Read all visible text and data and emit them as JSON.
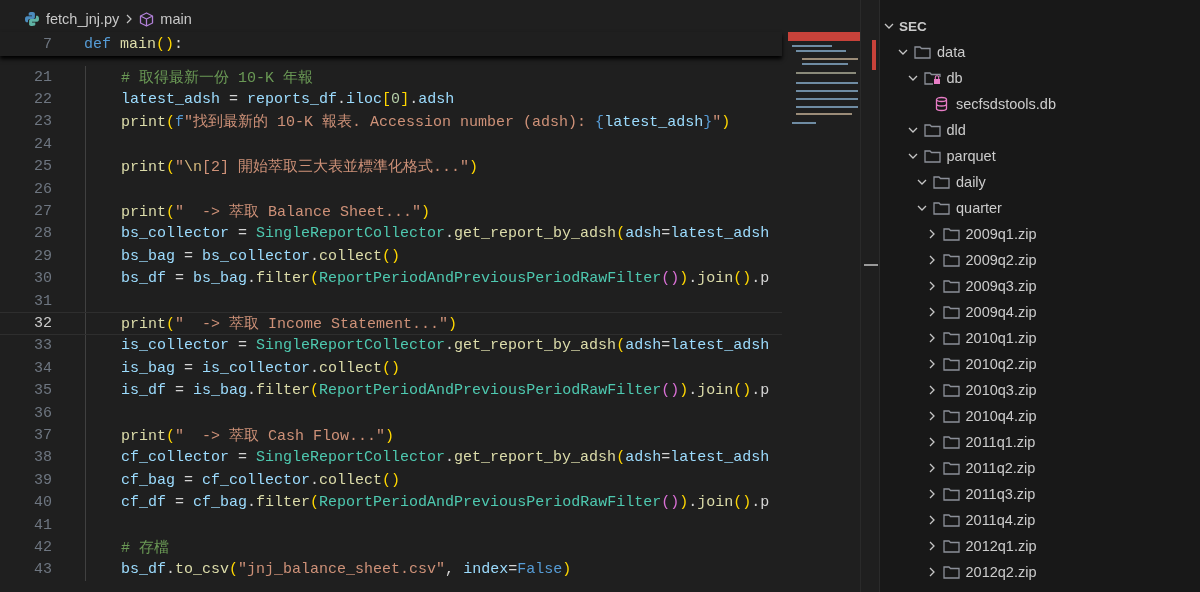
{
  "breadcrumb": {
    "file": "fetch_jnj.py",
    "symbol": "main"
  },
  "sticky_line": {
    "number": "7",
    "tokens": [
      {
        "text": "def ",
        "kind": "kw"
      },
      {
        "text": "main",
        "kind": "fn"
      },
      {
        "text": "()",
        "kind": "p1"
      },
      {
        "text": ":",
        "kind": "op"
      }
    ]
  },
  "lines": [
    {
      "number": "21",
      "active": false,
      "tokens": [
        {
          "text": "# 取得最新一份 10-K 年報",
          "kind": "cmt"
        }
      ]
    },
    {
      "number": "22",
      "active": false,
      "tokens": [
        {
          "text": "latest_adsh",
          "kind": "var"
        },
        {
          "text": " = ",
          "kind": "op"
        },
        {
          "text": "reports_df",
          "kind": "var"
        },
        {
          "text": ".",
          "kind": "op"
        },
        {
          "text": "iloc",
          "kind": "var"
        },
        {
          "text": "[",
          "kind": "p1"
        },
        {
          "text": "0",
          "kind": "num"
        },
        {
          "text": "]",
          "kind": "p1"
        },
        {
          "text": ".",
          "kind": "op"
        },
        {
          "text": "adsh",
          "kind": "var"
        }
      ]
    },
    {
      "number": "23",
      "active": false,
      "tokens": [
        {
          "text": "print",
          "kind": "fn"
        },
        {
          "text": "(",
          "kind": "p1"
        },
        {
          "text": "f",
          "kind": "kw"
        },
        {
          "text": "\"找到最新的 10-K 報表. Accession number (adsh): ",
          "kind": "str"
        },
        {
          "text": "{",
          "kind": "kw"
        },
        {
          "text": "latest_adsh",
          "kind": "var"
        },
        {
          "text": "}",
          "kind": "kw"
        },
        {
          "text": "\"",
          "kind": "str"
        },
        {
          "text": ")",
          "kind": "p1"
        }
      ]
    },
    {
      "number": "24",
      "active": false
    },
    {
      "number": "25",
      "active": false,
      "tokens": [
        {
          "text": "print",
          "kind": "fn"
        },
        {
          "text": "(",
          "kind": "p1"
        },
        {
          "text": "\"",
          "kind": "str"
        },
        {
          "text": "\\n",
          "kind": "esc"
        },
        {
          "text": "[2] 開始萃取三大表並標準化格式...\"",
          "kind": "str"
        },
        {
          "text": ")",
          "kind": "p1"
        }
      ]
    },
    {
      "number": "26",
      "active": false
    },
    {
      "number": "27",
      "active": false,
      "tokens": [
        {
          "text": "print",
          "kind": "fn"
        },
        {
          "text": "(",
          "kind": "p1"
        },
        {
          "text": "\"  -> 萃取 Balance Sheet...\"",
          "kind": "str"
        },
        {
          "text": ")",
          "kind": "p1"
        }
      ]
    },
    {
      "number": "28",
      "active": false,
      "tokens": [
        {
          "text": "bs_collector",
          "kind": "var"
        },
        {
          "text": " = ",
          "kind": "op"
        },
        {
          "text": "SingleReportCollector",
          "kind": "cls"
        },
        {
          "text": ".",
          "kind": "op"
        },
        {
          "text": "get_report_by_adsh",
          "kind": "fn"
        },
        {
          "text": "(",
          "kind": "p1"
        },
        {
          "text": "adsh",
          "kind": "var"
        },
        {
          "text": "=",
          "kind": "op"
        },
        {
          "text": "latest_adsh",
          "kind": "var"
        }
      ]
    },
    {
      "number": "29",
      "active": false,
      "tokens": [
        {
          "text": "bs_bag",
          "kind": "var"
        },
        {
          "text": " = ",
          "kind": "op"
        },
        {
          "text": "bs_collector",
          "kind": "var"
        },
        {
          "text": ".",
          "kind": "op"
        },
        {
          "text": "collect",
          "kind": "fn"
        },
        {
          "text": "()",
          "kind": "p1"
        }
      ]
    },
    {
      "number": "30",
      "active": false,
      "tokens": [
        {
          "text": "bs_df",
          "kind": "var"
        },
        {
          "text": " = ",
          "kind": "op"
        },
        {
          "text": "bs_bag",
          "kind": "var"
        },
        {
          "text": ".",
          "kind": "op"
        },
        {
          "text": "filter",
          "kind": "fn"
        },
        {
          "text": "(",
          "kind": "p1"
        },
        {
          "text": "ReportPeriodAndPreviousPeriodRawFilter",
          "kind": "cls"
        },
        {
          "text": "()",
          "kind": "p2"
        },
        {
          "text": ")",
          "kind": "p1"
        },
        {
          "text": ".",
          "kind": "op"
        },
        {
          "text": "join",
          "kind": "fn"
        },
        {
          "text": "()",
          "kind": "p1"
        },
        {
          "text": ".p",
          "kind": "op"
        }
      ]
    },
    {
      "number": "31",
      "active": false
    },
    {
      "number": "32",
      "active": true,
      "tokens": [
        {
          "text": "print",
          "kind": "fn"
        },
        {
          "text": "(",
          "kind": "p1"
        },
        {
          "text": "\"  -> 萃取 Income Statement...\"",
          "kind": "str"
        },
        {
          "text": ")",
          "kind": "p1"
        }
      ]
    },
    {
      "number": "33",
      "active": false,
      "tokens": [
        {
          "text": "is_collector",
          "kind": "var"
        },
        {
          "text": " = ",
          "kind": "op"
        },
        {
          "text": "SingleReportCollector",
          "kind": "cls"
        },
        {
          "text": ".",
          "kind": "op"
        },
        {
          "text": "get_report_by_adsh",
          "kind": "fn"
        },
        {
          "text": "(",
          "kind": "p1"
        },
        {
          "text": "adsh",
          "kind": "var"
        },
        {
          "text": "=",
          "kind": "op"
        },
        {
          "text": "latest_adsh",
          "kind": "var"
        }
      ]
    },
    {
      "number": "34",
      "active": false,
      "tokens": [
        {
          "text": "is_bag",
          "kind": "var"
        },
        {
          "text": " = ",
          "kind": "op"
        },
        {
          "text": "is_collector",
          "kind": "var"
        },
        {
          "text": ".",
          "kind": "op"
        },
        {
          "text": "collect",
          "kind": "fn"
        },
        {
          "text": "()",
          "kind": "p1"
        }
      ]
    },
    {
      "number": "35",
      "active": false,
      "tokens": [
        {
          "text": "is_df",
          "kind": "var"
        },
        {
          "text": " = ",
          "kind": "op"
        },
        {
          "text": "is_bag",
          "kind": "var"
        },
        {
          "text": ".",
          "kind": "op"
        },
        {
          "text": "filter",
          "kind": "fn"
        },
        {
          "text": "(",
          "kind": "p1"
        },
        {
          "text": "ReportPeriodAndPreviousPeriodRawFilter",
          "kind": "cls"
        },
        {
          "text": "()",
          "kind": "p2"
        },
        {
          "text": ")",
          "kind": "p1"
        },
        {
          "text": ".",
          "kind": "op"
        },
        {
          "text": "join",
          "kind": "fn"
        },
        {
          "text": "()",
          "kind": "p1"
        },
        {
          "text": ".p",
          "kind": "op"
        }
      ]
    },
    {
      "number": "36",
      "active": false
    },
    {
      "number": "37",
      "active": false,
      "tokens": [
        {
          "text": "print",
          "kind": "fn"
        },
        {
          "text": "(",
          "kind": "p1"
        },
        {
          "text": "\"  -> 萃取 Cash Flow...\"",
          "kind": "str"
        },
        {
          "text": ")",
          "kind": "p1"
        }
      ]
    },
    {
      "number": "38",
      "active": false,
      "tokens": [
        {
          "text": "cf_collector",
          "kind": "var"
        },
        {
          "text": " = ",
          "kind": "op"
        },
        {
          "text": "SingleReportCollector",
          "kind": "cls"
        },
        {
          "text": ".",
          "kind": "op"
        },
        {
          "text": "get_report_by_adsh",
          "kind": "fn"
        },
        {
          "text": "(",
          "kind": "p1"
        },
        {
          "text": "adsh",
          "kind": "var"
        },
        {
          "text": "=",
          "kind": "op"
        },
        {
          "text": "latest_adsh",
          "kind": "var"
        }
      ]
    },
    {
      "number": "39",
      "active": false,
      "tokens": [
        {
          "text": "cf_bag",
          "kind": "var"
        },
        {
          "text": " = ",
          "kind": "op"
        },
        {
          "text": "cf_collector",
          "kind": "var"
        },
        {
          "text": ".",
          "kind": "op"
        },
        {
          "text": "collect",
          "kind": "fn"
        },
        {
          "text": "()",
          "kind": "p1"
        }
      ]
    },
    {
      "number": "40",
      "active": false,
      "tokens": [
        {
          "text": "cf_df",
          "kind": "var"
        },
        {
          "text": " = ",
          "kind": "op"
        },
        {
          "text": "cf_bag",
          "kind": "var"
        },
        {
          "text": ".",
          "kind": "op"
        },
        {
          "text": "filter",
          "kind": "fn"
        },
        {
          "text": "(",
          "kind": "p1"
        },
        {
          "text": "ReportPeriodAndPreviousPeriodRawFilter",
          "kind": "cls"
        },
        {
          "text": "()",
          "kind": "p2"
        },
        {
          "text": ")",
          "kind": "p1"
        },
        {
          "text": ".",
          "kind": "op"
        },
        {
          "text": "join",
          "kind": "fn"
        },
        {
          "text": "()",
          "kind": "p1"
        },
        {
          "text": ".p",
          "kind": "op"
        }
      ]
    },
    {
      "number": "41",
      "active": false
    },
    {
      "number": "42",
      "active": false,
      "tokens": [
        {
          "text": "# 存檔",
          "kind": "cmt"
        }
      ]
    },
    {
      "number": "43",
      "active": false,
      "tokens": [
        {
          "text": "bs_df",
          "kind": "var"
        },
        {
          "text": ".",
          "kind": "op"
        },
        {
          "text": "to_csv",
          "kind": "fn"
        },
        {
          "text": "(",
          "kind": "p1"
        },
        {
          "text": "\"jnj_balance_sheet.csv\"",
          "kind": "str"
        },
        {
          "text": ", ",
          "kind": "op"
        },
        {
          "text": "index",
          "kind": "var"
        },
        {
          "text": "=",
          "kind": "op"
        },
        {
          "text": "False",
          "kind": "kw"
        },
        {
          "text": ")",
          "kind": "p1"
        }
      ]
    }
  ],
  "explorer": {
    "section": "SEC",
    "expanded": true,
    "items": [
      {
        "label": "data",
        "kind": "folder",
        "expanded": true,
        "children": [
          {
            "label": "db",
            "kind": "db_folder",
            "expanded": true,
            "children": [
              {
                "label": "secfsdstools.db",
                "kind": "db_file"
              }
            ]
          },
          {
            "label": "dld",
            "kind": "folder",
            "expanded": true
          },
          {
            "label": "parquet",
            "kind": "folder",
            "expanded": true,
            "children": [
              {
                "label": "daily",
                "kind": "folder",
                "expanded": true
              },
              {
                "label": "quarter",
                "kind": "folder",
                "expanded": true,
                "children": [
                  {
                    "label": "2009q1.zip",
                    "kind": "folder",
                    "expanded": false
                  },
                  {
                    "label": "2009q2.zip",
                    "kind": "folder",
                    "expanded": false
                  },
                  {
                    "label": "2009q3.zip",
                    "kind": "folder",
                    "expanded": false
                  },
                  {
                    "label": "2009q4.zip",
                    "kind": "folder",
                    "expanded": false
                  },
                  {
                    "label": "2010q1.zip",
                    "kind": "folder",
                    "expanded": false
                  },
                  {
                    "label": "2010q2.zip",
                    "kind": "folder",
                    "expanded": false
                  },
                  {
                    "label": "2010q3.zip",
                    "kind": "folder",
                    "expanded": false
                  },
                  {
                    "label": "2010q4.zip",
                    "kind": "folder",
                    "expanded": false
                  },
                  {
                    "label": "2011q1.zip",
                    "kind": "folder",
                    "expanded": false
                  },
                  {
                    "label": "2011q2.zip",
                    "kind": "folder",
                    "expanded": false
                  },
                  {
                    "label": "2011q3.zip",
                    "kind": "folder",
                    "expanded": false
                  },
                  {
                    "label": "2011q4.zip",
                    "kind": "folder",
                    "expanded": false
                  },
                  {
                    "label": "2012q1.zip",
                    "kind": "folder",
                    "expanded": false
                  },
                  {
                    "label": "2012q2.zip",
                    "kind": "folder",
                    "expanded": false
                  }
                ]
              }
            ]
          }
        ]
      }
    ]
  }
}
